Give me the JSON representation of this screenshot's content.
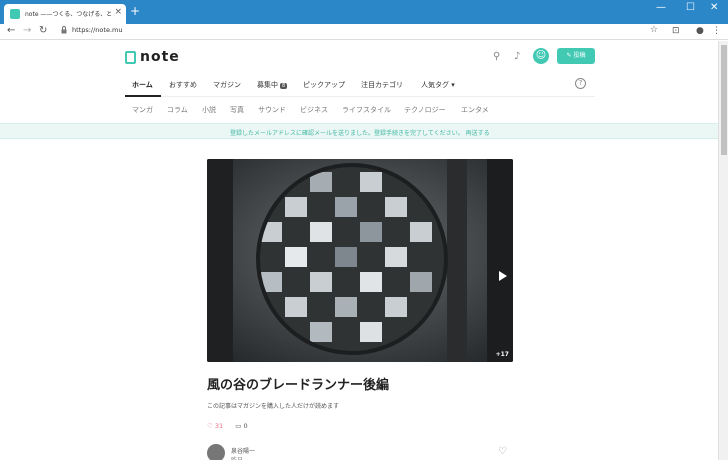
{
  "browser": {
    "tab_title": "note ——つくる、つなげる、とどける。",
    "url": "https://note.mu",
    "new_tab": "+",
    "close_tab": "×",
    "win_min": "—",
    "win_max": "☐",
    "win_close": "✕"
  },
  "header": {
    "logo_text": "note",
    "post_button": "✎ 投稿",
    "avatar_glyph": "☺"
  },
  "tabs": [
    {
      "label": "ホーム",
      "active": true
    },
    {
      "label": "おすすめ"
    },
    {
      "label": "マガジン"
    },
    {
      "label": "募集中",
      "badge": "8"
    },
    {
      "label": "ピックアップ"
    },
    {
      "label": "注目カテゴリ"
    },
    {
      "label": "人気タグ ▾"
    }
  ],
  "help_glyph": "?",
  "subtabs": [
    "マンガ",
    "コラム",
    "小説",
    "写真",
    "サウンド",
    "ビジネス",
    "ライフスタイル",
    "テクノロジー",
    "エンタメ"
  ],
  "notice": {
    "text": "登録したメールアドレスに確認メールを送りました。登録手続きを完了してください。",
    "link": "再送する"
  },
  "article": {
    "image_count": "+17",
    "title": "風の谷のブレードランナー後編",
    "description": "この記事はマガジンを購入した人だけが読めます",
    "likes": "31",
    "comments": "0",
    "author": "泉谷陽一",
    "date": "昨日"
  },
  "colors": {
    "accent": "#41c9b4",
    "chrome": "#2c87c8"
  }
}
